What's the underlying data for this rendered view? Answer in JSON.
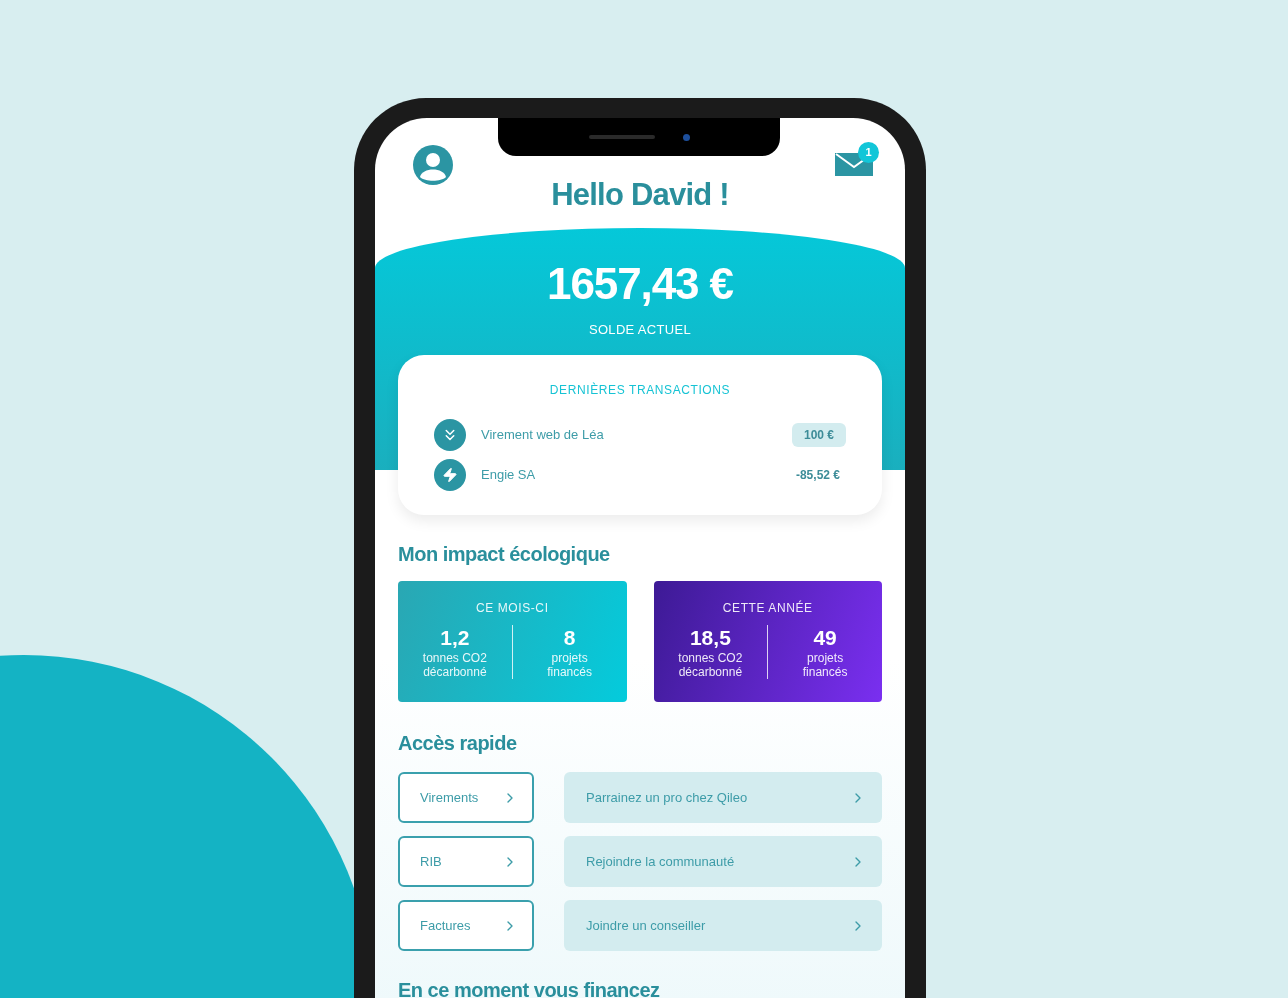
{
  "header": {
    "notification_count": "1"
  },
  "greeting": "Hello David !",
  "balance": {
    "amount": "1657,43 €",
    "label": "SOLDE ACTUEL"
  },
  "transactions": {
    "title": "DERNIÈRES TRANSACTIONS",
    "items": [
      {
        "kind": "incoming",
        "label": "Virement web de Léa",
        "amount": "100 €",
        "highlighted": true
      },
      {
        "kind": "energy",
        "label": "Engie SA",
        "amount": "-85,52 €",
        "highlighted": false
      }
    ]
  },
  "impact": {
    "title": "Mon impact écologique",
    "cards": [
      {
        "kind": "month",
        "title": "CE MOIS-CI",
        "stats": [
          {
            "value": "1,2",
            "label": "tonnes CO2 décarbonné"
          },
          {
            "value": "8",
            "label": "projets financés"
          }
        ]
      },
      {
        "kind": "year",
        "title": "CETTE ANNÉE",
        "stats": [
          {
            "value": "18,5",
            "label": "tonnes CO2 décarbonné"
          },
          {
            "value": "49",
            "label": "projets financés"
          }
        ]
      }
    ]
  },
  "quick_access": {
    "title": "Accès rapide",
    "rows": [
      {
        "primary": "Virements",
        "secondary": "Parrainez un pro chez Qileo"
      },
      {
        "primary": "RIB",
        "secondary": "Rejoindre la communauté"
      },
      {
        "primary": "Factures",
        "secondary": "Joindre un conseiller"
      }
    ]
  },
  "next_section": {
    "title": "En ce moment vous financez"
  }
}
